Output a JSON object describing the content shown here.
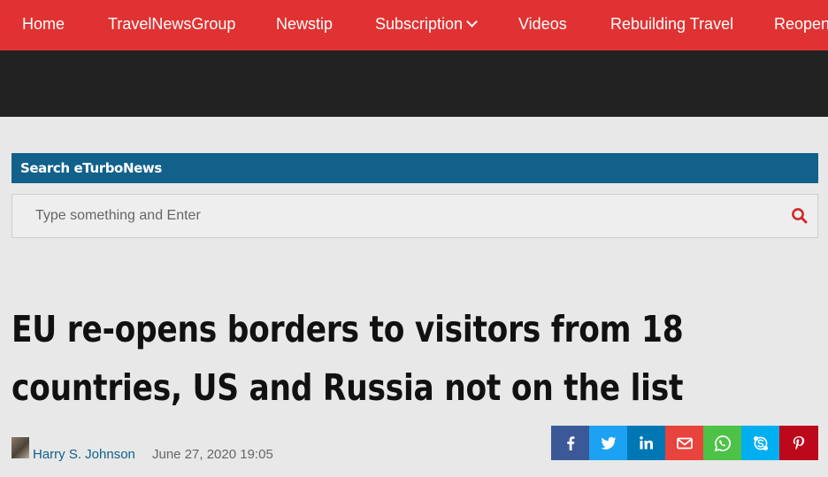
{
  "nav": {
    "items": [
      "Home",
      "TravelNewsGroup",
      "Newstip",
      "Subscription",
      "Videos",
      "Rebuilding Travel",
      "Reopen"
    ]
  },
  "search": {
    "heading": "Search eTurboNews",
    "placeholder": "Type something and Enter",
    "icon": "search-icon"
  },
  "article": {
    "title_line1": "EU re-opens borders to visitors from 18",
    "title_line2": "countries, US and Russia not on the list",
    "author": "Harry S. Johnson",
    "date": "June 27, 2020 19:05"
  },
  "share": {
    "buttons": [
      {
        "icon": "facebook-icon",
        "color": "#3b5998"
      },
      {
        "icon": "twitter-icon",
        "color": "#1da1f2"
      },
      {
        "icon": "linkedin-icon",
        "color": "#0077b5"
      },
      {
        "icon": "email-icon",
        "color": "#e8433c"
      },
      {
        "icon": "whatsapp-icon",
        "color": "#4dc247"
      },
      {
        "icon": "skype-icon",
        "color": "#00aff0"
      },
      {
        "icon": "pinterest-icon",
        "color": "#bd081c"
      }
    ]
  },
  "colors": {
    "nav_bg": "#e03232",
    "dark_band": "#222222",
    "search_header_bg": "#11618b",
    "page_bg": "#e8e8e8"
  }
}
